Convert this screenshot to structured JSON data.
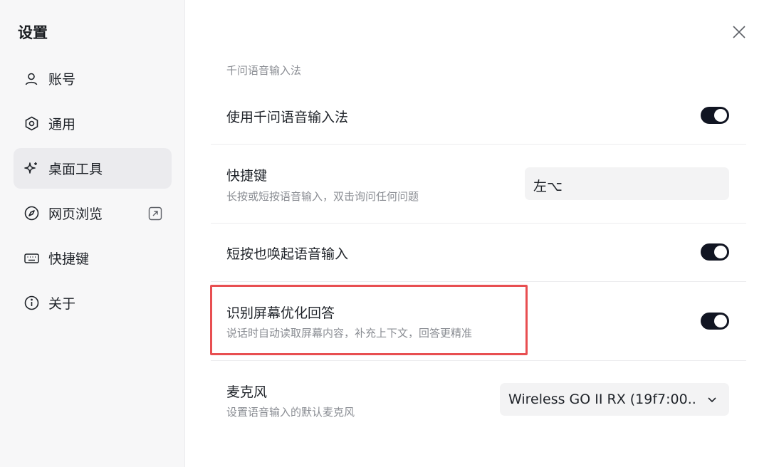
{
  "sidebar": {
    "title": "设置",
    "items": [
      {
        "label": "账号",
        "icon": "user-icon"
      },
      {
        "label": "通用",
        "icon": "hexagon-settings-icon"
      },
      {
        "label": "桌面工具",
        "icon": "sparkle-icon",
        "active": true
      },
      {
        "label": "网页浏览",
        "icon": "compass-icon",
        "external": true
      },
      {
        "label": "快捷键",
        "icon": "keyboard-icon"
      },
      {
        "label": "关于",
        "icon": "info-icon"
      }
    ]
  },
  "main": {
    "section_title": "千问语音输入法",
    "rows": {
      "use_ime": {
        "title": "使用千问语音输入法",
        "enabled": true
      },
      "shortcut": {
        "title": "快捷键",
        "desc": "长按或短按语音输入，双击询问任何问题",
        "value": "左⌥"
      },
      "short_press": {
        "title": "短按也唤起语音输入",
        "enabled": true
      },
      "screen_recognition": {
        "title": "识别屏幕优化回答",
        "desc": "说话时自动读取屏幕内容，补充上下文，回答更精准",
        "enabled": true
      },
      "microphone": {
        "title": "麦克风",
        "desc": "设置语音输入的默认麦克风",
        "value": "Wireless GO II RX (19f7:00..."
      }
    }
  },
  "colors": {
    "toggle_on": "#111522",
    "highlight": "#e84f51",
    "sidebar_bg": "#f7f7f8",
    "active_item_bg": "#ebebee"
  }
}
